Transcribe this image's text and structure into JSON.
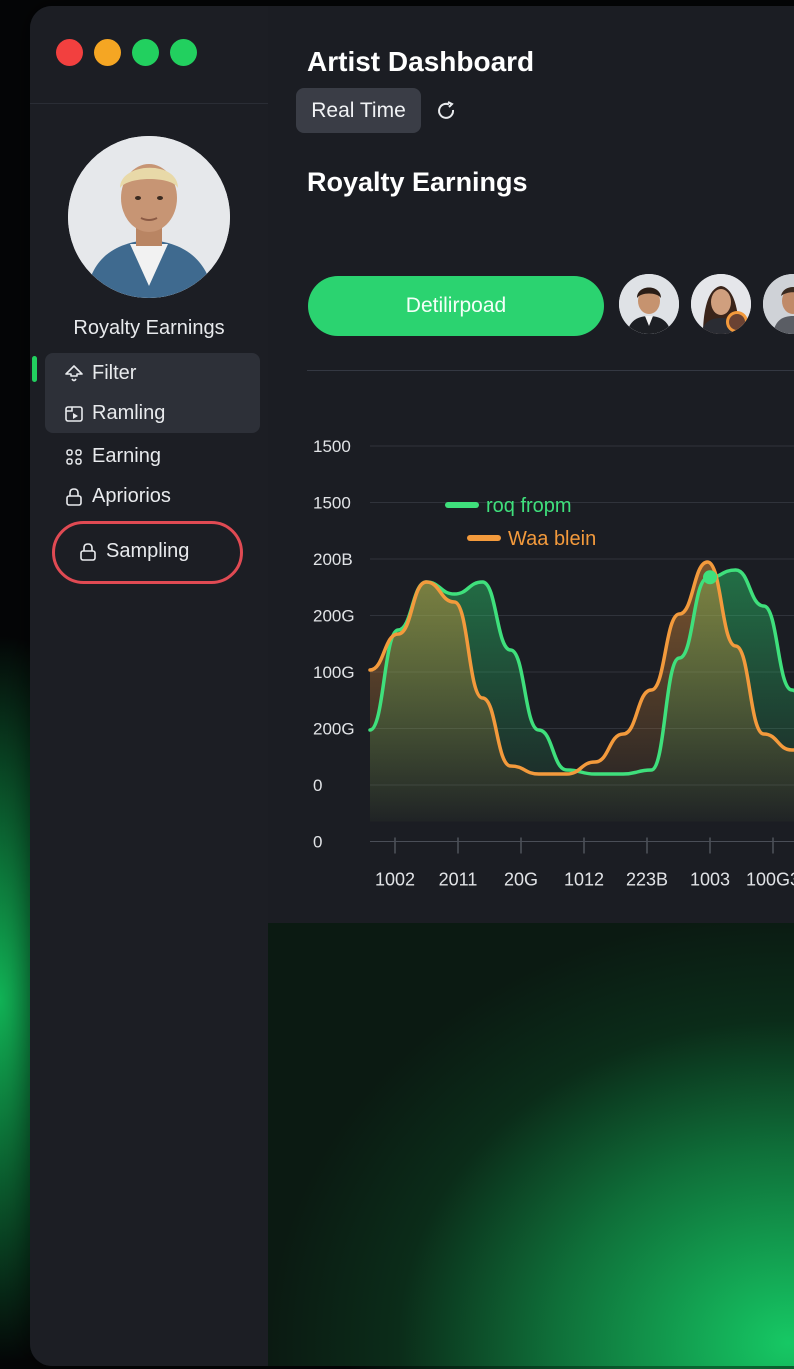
{
  "app": {
    "title": "Artist Dashboard",
    "realtime_label": "Real Time",
    "section_title": "Royalty Earnings",
    "primary_action_label": "Detilirpoad"
  },
  "sidebar": {
    "profile_name": "Royalty Earnings",
    "items": [
      {
        "label": "Filter",
        "icon": "filter-icon"
      },
      {
        "label": "Ramling",
        "icon": "media-icon"
      },
      {
        "label": "Earning",
        "icon": "grid-icon"
      },
      {
        "label": "Apriorios",
        "icon": "lock-icon"
      },
      {
        "label": "Sampling",
        "icon": "lock-icon"
      }
    ]
  },
  "colors": {
    "accent_green": "#2bd370",
    "series_green": "#3fe07c",
    "series_orange": "#f39a3c",
    "highlight_red": "#e04a53"
  },
  "chart_data": {
    "type": "area",
    "y_tick_labels": [
      "1500",
      "1500",
      "200B",
      "200G",
      "100G",
      "200G",
      "0",
      "0"
    ],
    "x_tick_labels": [
      "1002",
      "2011",
      "20G",
      "1012",
      "223B",
      "1003",
      "100G3"
    ],
    "legend": [
      "roq fropm",
      "Waa blein"
    ],
    "legend_position": "top-left",
    "grid": true,
    "series": [
      {
        "name": "roq fropm",
        "color": "#3fe07c",
        "values": [
          1.2,
          3.7,
          4.9,
          4.6,
          4.9,
          3.2,
          1.2,
          0.2,
          0.1,
          0.1,
          0.2,
          3.0,
          5.0,
          5.2,
          4.3,
          2.2,
          0.6
        ]
      },
      {
        "name": "Waa blein",
        "color": "#f39a3c",
        "values": [
          2.7,
          3.6,
          4.9,
          4.4,
          2.0,
          0.3,
          0.1,
          0.1,
          0.4,
          1.1,
          2.2,
          4.1,
          5.4,
          3.3,
          1.1,
          0.7,
          0.7
        ]
      }
    ],
    "highlight_point": {
      "series": "roq fropm",
      "x_label": "1003"
    }
  }
}
